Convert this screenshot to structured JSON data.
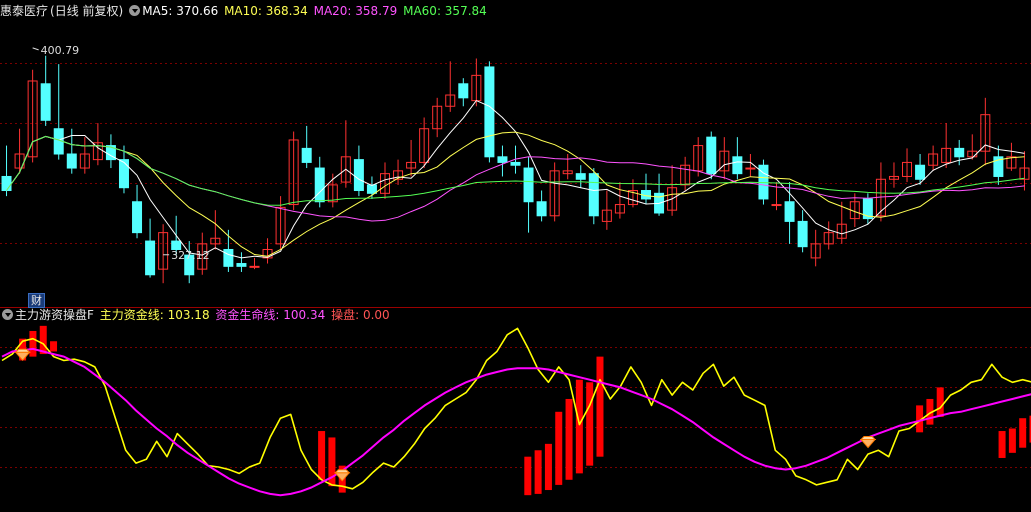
{
  "top_header": {
    "stock_name": "惠泰医疗",
    "period": "(日线 前复权)",
    "ma5": "MA5: 370.66",
    "ma10": "MA10: 368.34",
    "ma20": "MA20: 358.79",
    "ma60": "MA60: 357.84"
  },
  "bottom_header": {
    "indicator_name": "主力游资操盘F",
    "main_fund": "主力资金线: 103.18",
    "life_line": "资金生命线: 100.34",
    "operate": "操盘: 0.00"
  },
  "badge": "财",
  "colors": {
    "up": "#ff3232",
    "down": "#54ffff",
    "ma5": "#ffffff",
    "ma10": "#ffff54",
    "ma20": "#ff54ff",
    "ma60": "#54ff54",
    "grid": "#7a0000",
    "fund": "#ffff00",
    "life": "#ff00ff",
    "bar": "#ff0000",
    "text": "#e6e6e6"
  },
  "chart_data": [
    {
      "type": "candlestick",
      "panel": "price",
      "ylim": [
        316,
        410
      ],
      "annotations": [
        {
          "text": "400.79",
          "value": 400.79,
          "index": 2
        },
        {
          "text": "327.12",
          "value": 327.12,
          "index": 12
        }
      ],
      "candles": [
        [
          355,
          350,
          366,
          348
        ],
        [
          358,
          363,
          372,
          356
        ],
        [
          362,
          389,
          393,
          360
        ],
        [
          388,
          375,
          398,
          373
        ],
        [
          372,
          363,
          395,
          361
        ],
        [
          363,
          358,
          372,
          356
        ],
        [
          358,
          363,
          369,
          356
        ],
        [
          361,
          367,
          374,
          359
        ],
        [
          366,
          361,
          370,
          358
        ],
        [
          361,
          351,
          366,
          349
        ],
        [
          346,
          335,
          352,
          333
        ],
        [
          332,
          320,
          340,
          319
        ],
        [
          322,
          335,
          338,
          317
        ],
        [
          332,
          329,
          341,
          327
        ],
        [
          327,
          320,
          332,
          317
        ],
        [
          322,
          331,
          335,
          320
        ],
        [
          331,
          333,
          343,
          329
        ],
        [
          329,
          323,
          336,
          321
        ],
        [
          324,
          323,
          328,
          321
        ],
        [
          323,
          323,
          326,
          322
        ],
        [
          326,
          329,
          333,
          324
        ],
        [
          331,
          344,
          348,
          329
        ],
        [
          345,
          368,
          371,
          343
        ],
        [
          365,
          360,
          373,
          358
        ],
        [
          358,
          346,
          362,
          344
        ],
        [
          346,
          352,
          356,
          344
        ],
        [
          353,
          362,
          375,
          351
        ],
        [
          361,
          350,
          366,
          348
        ],
        [
          352,
          349,
          355,
          347
        ],
        [
          349,
          356,
          360,
          347
        ],
        [
          354,
          357,
          361,
          352
        ],
        [
          358,
          360,
          368,
          355
        ],
        [
          360,
          372,
          376,
          358
        ],
        [
          372,
          380,
          383,
          369
        ],
        [
          380,
          384,
          396,
          378
        ],
        [
          388,
          383,
          390,
          380
        ],
        [
          382,
          391,
          397,
          380
        ],
        [
          394,
          362,
          396,
          360
        ],
        [
          362,
          360,
          366,
          355
        ],
        [
          360,
          359,
          366,
          356
        ],
        [
          358,
          346,
          362,
          335
        ],
        [
          346,
          341,
          350,
          339
        ],
        [
          341,
          357,
          360,
          339
        ],
        [
          356,
          357,
          363,
          354
        ],
        [
          356,
          354,
          359,
          351
        ],
        [
          356,
          341,
          358,
          338
        ],
        [
          339,
          343,
          350,
          336
        ],
        [
          342,
          345,
          353,
          340
        ],
        [
          345,
          350,
          354,
          344
        ],
        [
          350,
          347,
          356,
          345
        ],
        [
          349,
          342,
          356,
          341
        ],
        [
          343,
          351,
          359,
          341
        ],
        [
          352,
          359,
          362,
          350
        ],
        [
          357,
          366,
          369,
          355
        ],
        [
          369,
          356,
          371,
          354
        ],
        [
          357,
          364,
          369,
          354
        ],
        [
          362,
          356,
          369,
          354
        ],
        [
          358,
          358,
          363,
          355
        ],
        [
          359,
          347,
          361,
          345
        ],
        [
          345,
          345,
          353,
          343
        ],
        [
          346,
          339,
          353,
          331
        ],
        [
          339,
          330,
          343,
          328
        ],
        [
          326,
          331,
          336,
          323
        ],
        [
          331,
          335,
          339,
          329
        ],
        [
          333,
          338,
          346,
          331
        ],
        [
          340,
          346,
          349,
          337
        ],
        [
          347,
          340,
          349,
          338
        ],
        [
          341,
          354,
          360,
          339
        ],
        [
          354,
          355,
          360,
          351
        ],
        [
          355,
          360,
          365,
          353
        ],
        [
          359,
          354,
          363,
          352
        ],
        [
          359,
          363,
          366,
          357
        ],
        [
          360,
          365,
          374,
          358
        ],
        [
          365,
          362,
          368,
          359
        ],
        [
          362,
          364,
          370,
          361
        ],
        [
          364,
          377,
          383,
          359
        ],
        [
          362,
          355,
          366,
          352
        ],
        [
          358,
          362,
          367,
          357
        ],
        [
          354,
          358,
          364,
          350
        ]
      ],
      "ma_series": [
        "ma5",
        "ma10",
        "ma20",
        "ma60"
      ]
    },
    {
      "type": "line+bar",
      "panel": "indicator",
      "ylim": [
        0,
        145
      ],
      "series": [
        {
          "key": "fund",
          "values": [
            115,
            120,
            130,
            132,
            128,
            118,
            115,
            116,
            114,
            110,
            95,
            70,
            45,
            35,
            38,
            52,
            40,
            58,
            50,
            42,
            33,
            32,
            30,
            27,
            32,
            35,
            55,
            70,
            73,
            45,
            30,
            22,
            18,
            17,
            15,
            20,
            28,
            35,
            32,
            40,
            50,
            62,
            70,
            80,
            85,
            90,
            100,
            115,
            122,
            135,
            140,
            125,
            108,
            98,
            110,
            100,
            65,
            80,
            100,
            85,
            95,
            110,
            98,
            80,
            100,
            88,
            98,
            92,
            105,
            112,
            95,
            102,
            88,
            84,
            80,
            45,
            38,
            25,
            22,
            18,
            20,
            22,
            38,
            30,
            42,
            45,
            40,
            60,
            62,
            68,
            74,
            78,
            88,
            92,
            98,
            100,
            112,
            102,
            98,
            100,
            98
          ]
        },
        {
          "key": "life",
          "values": [
            118,
            122,
            123,
            124,
            122,
            120,
            118,
            114,
            110,
            104,
            98,
            91,
            84,
            76,
            69,
            62,
            56,
            49,
            43,
            38,
            33,
            28,
            23,
            19,
            16,
            13,
            11,
            10,
            11,
            13,
            16,
            20,
            24,
            29,
            35,
            41,
            48,
            55,
            61,
            68,
            74,
            80,
            85,
            90,
            94,
            98,
            101,
            104,
            106,
            108,
            109,
            109,
            109,
            108,
            106,
            104,
            102,
            100,
            98,
            96,
            94,
            91,
            88,
            85,
            81,
            77,
            72,
            67,
            61,
            55,
            50,
            45,
            40,
            36,
            33,
            31,
            30,
            31,
            33,
            36,
            39,
            43,
            47,
            51,
            55,
            58,
            61,
            64,
            66,
            68,
            70,
            72,
            74,
            75,
            77,
            79,
            81,
            83,
            85,
            87,
            89
          ]
        }
      ],
      "bars": [
        [
          2,
          115,
          132
        ],
        [
          3,
          118,
          138
        ],
        [
          4,
          120,
          142
        ],
        [
          5,
          122,
          130
        ],
        [
          31,
          22,
          60
        ],
        [
          32,
          17,
          55
        ],
        [
          33,
          12,
          33
        ],
        [
          51,
          10,
          40
        ],
        [
          52,
          11,
          45
        ],
        [
          53,
          14,
          50
        ],
        [
          54,
          18,
          75
        ],
        [
          55,
          22,
          85
        ],
        [
          56,
          27,
          100
        ],
        [
          57,
          33,
          98
        ],
        [
          58,
          40,
          118
        ],
        [
          89,
          59,
          80
        ],
        [
          90,
          65,
          85
        ],
        [
          91,
          71,
          94
        ],
        [
          97,
          39,
          60
        ],
        [
          98,
          43,
          62
        ],
        [
          99,
          47,
          70
        ],
        [
          100,
          51,
          72
        ],
        [
          101,
          55,
          80
        ],
        [
          102,
          58,
          85
        ],
        [
          103,
          62,
          88
        ],
        [
          104,
          65,
          92
        ],
        [
          105,
          68,
          98
        ],
        [
          106,
          70,
          100
        ],
        [
          107,
          74,
          112
        ]
      ],
      "markers": [
        2,
        33,
        84,
        105
      ]
    }
  ]
}
